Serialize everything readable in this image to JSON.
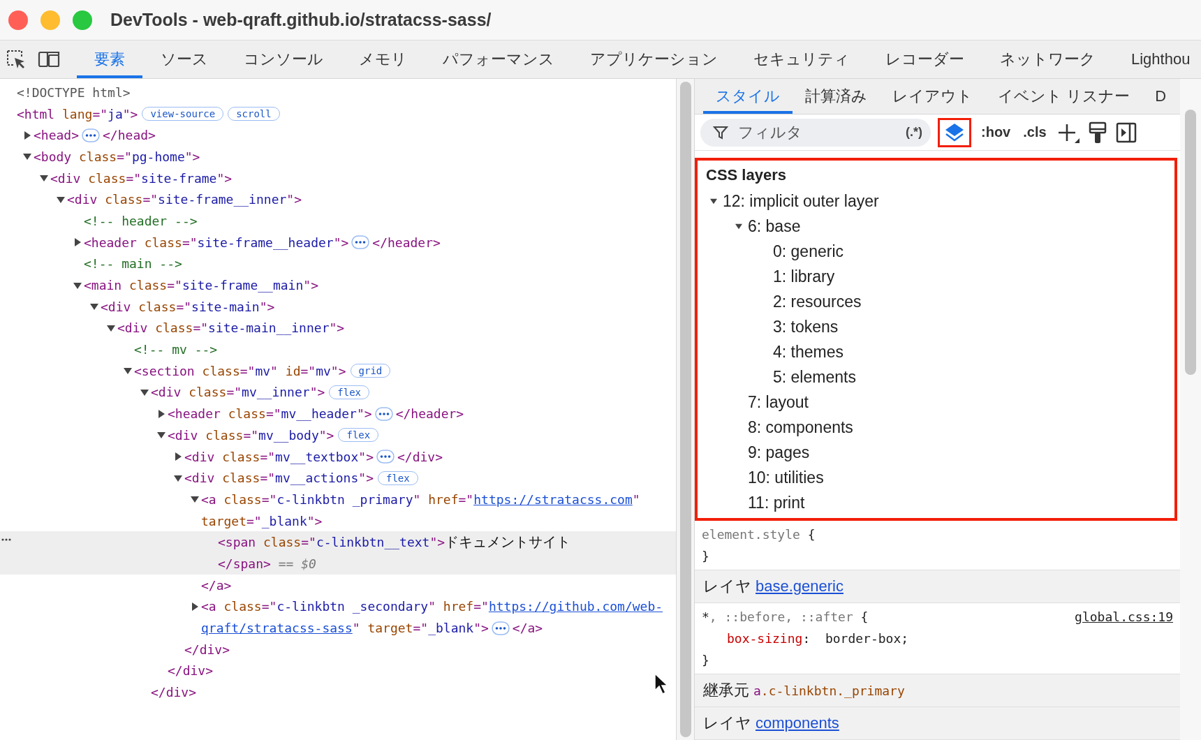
{
  "window": {
    "title": "DevTools - web-qraft.github.io/stratacss-sass/"
  },
  "main_tabs": [
    {
      "label": "要素",
      "selected": true
    },
    {
      "label": "ソース",
      "selected": false
    },
    {
      "label": "コンソール",
      "selected": false
    },
    {
      "label": "メモリ",
      "selected": false
    },
    {
      "label": "パフォーマンス",
      "selected": false
    },
    {
      "label": "アプリケーション",
      "selected": false
    },
    {
      "label": "セキュリティ",
      "selected": false
    },
    {
      "label": "レコーダー",
      "selected": false
    },
    {
      "label": "ネットワーク",
      "selected": false
    },
    {
      "label": "Lighthou",
      "selected": false
    }
  ],
  "dom_tree": {
    "nodes": [
      {
        "selected": false,
        "lines": [
          [
            {
              "kind": "doctype",
              "text": "<!DOCTYPE html>"
            }
          ]
        ]
      },
      {
        "selected": false,
        "lines": [
          [
            {
              "kind": "tag",
              "text": "<html"
            },
            {
              "kind": "attr",
              "text": " lang"
            },
            {
              "kind": "tag",
              "text": "=\""
            },
            {
              "kind": "val",
              "text": "ja"
            },
            {
              "kind": "tag",
              "text": "\">"
            },
            {
              "kind": "badge",
              "text": "view-source"
            },
            {
              "kind": "badge",
              "text": "scroll"
            }
          ]
        ],
        "children": [
          {
            "expanded": false,
            "selected": false,
            "lines": [
              [
                {
                  "kind": "tag",
                  "text": "<head>"
                },
                {
                  "kind": "more"
                },
                {
                  "kind": "tag",
                  "text": "</head>"
                }
              ]
            ]
          },
          {
            "expanded": true,
            "selected": false,
            "lines": [
              [
                {
                  "kind": "tag",
                  "text": "<body"
                },
                {
                  "kind": "attr",
                  "text": " class"
                },
                {
                  "kind": "tag",
                  "text": "=\""
                },
                {
                  "kind": "val",
                  "text": "pg-home"
                },
                {
                  "kind": "tag",
                  "text": "\">"
                }
              ]
            ],
            "children": [
              {
                "expanded": true,
                "selected": false,
                "lines": [
                  [
                    {
                      "kind": "tag",
                      "text": "<div"
                    },
                    {
                      "kind": "attr",
                      "text": " class"
                    },
                    {
                      "kind": "tag",
                      "text": "=\""
                    },
                    {
                      "kind": "val",
                      "text": "site-frame"
                    },
                    {
                      "kind": "tag",
                      "text": "\">"
                    }
                  ]
                ],
                "children": [
                  {
                    "expanded": true,
                    "selected": false,
                    "lines": [
                      [
                        {
                          "kind": "tag",
                          "text": "<div"
                        },
                        {
                          "kind": "attr",
                          "text": " class"
                        },
                        {
                          "kind": "tag",
                          "text": "=\""
                        },
                        {
                          "kind": "val",
                          "text": "site-frame__inner"
                        },
                        {
                          "kind": "tag",
                          "text": "\">"
                        }
                      ]
                    ],
                    "children": [
                      {
                        "selected": false,
                        "lines": [
                          [
                            {
                              "kind": "comment",
                              "text": "<!-- header -->"
                            }
                          ]
                        ]
                      },
                      {
                        "expanded": false,
                        "selected": false,
                        "lines": [
                          [
                            {
                              "kind": "tag",
                              "text": "<header"
                            },
                            {
                              "kind": "attr",
                              "text": " class"
                            },
                            {
                              "kind": "tag",
                              "text": "=\""
                            },
                            {
                              "kind": "val",
                              "text": "site-frame__header"
                            },
                            {
                              "kind": "tag",
                              "text": "\">"
                            },
                            {
                              "kind": "more"
                            },
                            {
                              "kind": "tag",
                              "text": "</header>"
                            }
                          ]
                        ]
                      },
                      {
                        "selected": false,
                        "lines": [
                          [
                            {
                              "kind": "comment",
                              "text": "<!-- main -->"
                            }
                          ]
                        ]
                      },
                      {
                        "expanded": true,
                        "selected": false,
                        "lines": [
                          [
                            {
                              "kind": "tag",
                              "text": "<main"
                            },
                            {
                              "kind": "attr",
                              "text": " class"
                            },
                            {
                              "kind": "tag",
                              "text": "=\""
                            },
                            {
                              "kind": "val",
                              "text": "site-frame__main"
                            },
                            {
                              "kind": "tag",
                              "text": "\">"
                            }
                          ]
                        ],
                        "children": [
                          {
                            "expanded": true,
                            "selected": false,
                            "lines": [
                              [
                                {
                                  "kind": "tag",
                                  "text": "<div"
                                },
                                {
                                  "kind": "attr",
                                  "text": " class"
                                },
                                {
                                  "kind": "tag",
                                  "text": "=\""
                                },
                                {
                                  "kind": "val",
                                  "text": "site-main"
                                },
                                {
                                  "kind": "tag",
                                  "text": "\">"
                                }
                              ]
                            ],
                            "children": [
                              {
                                "expanded": true,
                                "selected": false,
                                "lines": [
                                  [
                                    {
                                      "kind": "tag",
                                      "text": "<div"
                                    },
                                    {
                                      "kind": "attr",
                                      "text": " class"
                                    },
                                    {
                                      "kind": "tag",
                                      "text": "=\""
                                    },
                                    {
                                      "kind": "val",
                                      "text": "site-main__inner"
                                    },
                                    {
                                      "kind": "tag",
                                      "text": "\">"
                                    }
                                  ]
                                ],
                                "children": [
                                  {
                                    "selected": false,
                                    "lines": [
                                      [
                                        {
                                          "kind": "comment",
                                          "text": "<!-- mv -->"
                                        }
                                      ]
                                    ]
                                  },
                                  {
                                    "expanded": true,
                                    "selected": false,
                                    "lines": [
                                      [
                                        {
                                          "kind": "tag",
                                          "text": "<section"
                                        },
                                        {
                                          "kind": "attr",
                                          "text": " class"
                                        },
                                        {
                                          "kind": "tag",
                                          "text": "=\""
                                        },
                                        {
                                          "kind": "val",
                                          "text": "mv"
                                        },
                                        {
                                          "kind": "tag",
                                          "text": "\""
                                        },
                                        {
                                          "kind": "attr",
                                          "text": " id"
                                        },
                                        {
                                          "kind": "tag",
                                          "text": "=\""
                                        },
                                        {
                                          "kind": "val",
                                          "text": "mv"
                                        },
                                        {
                                          "kind": "tag",
                                          "text": "\">"
                                        },
                                        {
                                          "kind": "badge",
                                          "text": "grid"
                                        }
                                      ]
                                    ],
                                    "children": [
                                      {
                                        "expanded": true,
                                        "selected": false,
                                        "lines": [
                                          [
                                            {
                                              "kind": "tag",
                                              "text": "<div"
                                            },
                                            {
                                              "kind": "attr",
                                              "text": " class"
                                            },
                                            {
                                              "kind": "tag",
                                              "text": "=\""
                                            },
                                            {
                                              "kind": "val",
                                              "text": "mv__inner"
                                            },
                                            {
                                              "kind": "tag",
                                              "text": "\">"
                                            },
                                            {
                                              "kind": "badge",
                                              "text": "flex"
                                            }
                                          ]
                                        ],
                                        "children": [
                                          {
                                            "expanded": false,
                                            "selected": false,
                                            "lines": [
                                              [
                                                {
                                                  "kind": "tag",
                                                  "text": "<header"
                                                },
                                                {
                                                  "kind": "attr",
                                                  "text": " class"
                                                },
                                                {
                                                  "kind": "tag",
                                                  "text": "=\""
                                                },
                                                {
                                                  "kind": "val",
                                                  "text": "mv__header"
                                                },
                                                {
                                                  "kind": "tag",
                                                  "text": "\">"
                                                },
                                                {
                                                  "kind": "more"
                                                },
                                                {
                                                  "kind": "tag",
                                                  "text": "</header>"
                                                }
                                              ]
                                            ]
                                          },
                                          {
                                            "expanded": true,
                                            "selected": false,
                                            "lines": [
                                              [
                                                {
                                                  "kind": "tag",
                                                  "text": "<div"
                                                },
                                                {
                                                  "kind": "attr",
                                                  "text": " class"
                                                },
                                                {
                                                  "kind": "tag",
                                                  "text": "=\""
                                                },
                                                {
                                                  "kind": "val",
                                                  "text": "mv__body"
                                                },
                                                {
                                                  "kind": "tag",
                                                  "text": "\">"
                                                },
                                                {
                                                  "kind": "badge",
                                                  "text": "flex"
                                                }
                                              ]
                                            ],
                                            "children": [
                                              {
                                                "expanded": false,
                                                "selected": false,
                                                "lines": [
                                                  [
                                                    {
                                                      "kind": "tag",
                                                      "text": "<div"
                                                    },
                                                    {
                                                      "kind": "attr",
                                                      "text": " class"
                                                    },
                                                    {
                                                      "kind": "tag",
                                                      "text": "=\""
                                                    },
                                                    {
                                                      "kind": "val",
                                                      "text": "mv__textbox"
                                                    },
                                                    {
                                                      "kind": "tag",
                                                      "text": "\">"
                                                    },
                                                    {
                                                      "kind": "more"
                                                    },
                                                    {
                                                      "kind": "tag",
                                                      "text": "</div>"
                                                    }
                                                  ]
                                                ]
                                              },
                                              {
                                                "expanded": true,
                                                "selected": false,
                                                "lines": [
                                                  [
                                                    {
                                                      "kind": "tag",
                                                      "text": "<div"
                                                    },
                                                    {
                                                      "kind": "attr",
                                                      "text": " class"
                                                    },
                                                    {
                                                      "kind": "tag",
                                                      "text": "=\""
                                                    },
                                                    {
                                                      "kind": "val",
                                                      "text": "mv__actions"
                                                    },
                                                    {
                                                      "kind": "tag",
                                                      "text": "\">"
                                                    },
                                                    {
                                                      "kind": "badge",
                                                      "text": "flex"
                                                    }
                                                  ]
                                                ],
                                                "children": [
                                                  {
                                                    "expanded": true,
                                                    "selected": false,
                                                    "lines": [
                                                      [
                                                        {
                                                          "kind": "tag",
                                                          "text": "<a"
                                                        },
                                                        {
                                                          "kind": "attr",
                                                          "text": " class"
                                                        },
                                                        {
                                                          "kind": "tag",
                                                          "text": "=\""
                                                        },
                                                        {
                                                          "kind": "val",
                                                          "text": "c-linkbtn _primary"
                                                        },
                                                        {
                                                          "kind": "tag",
                                                          "text": "\""
                                                        },
                                                        {
                                                          "kind": "attr",
                                                          "text": " href"
                                                        },
                                                        {
                                                          "kind": "tag",
                                                          "text": "=\""
                                                        },
                                                        {
                                                          "kind": "link",
                                                          "text": "https://stratacss.com"
                                                        },
                                                        {
                                                          "kind": "tag",
                                                          "text": "\""
                                                        }
                                                      ],
                                                      [
                                                        {
                                                          "kind": "attr",
                                                          "text": "target"
                                                        },
                                                        {
                                                          "kind": "tag",
                                                          "text": "=\""
                                                        },
                                                        {
                                                          "kind": "val",
                                                          "text": "_blank"
                                                        },
                                                        {
                                                          "kind": "tag",
                                                          "text": "\">"
                                                        }
                                                      ]
                                                    ],
                                                    "children": [
                                                      {
                                                        "selected": true,
                                                        "lines": [
                                                          [
                                                            {
                                                              "kind": "tag",
                                                              "text": "<span"
                                                            },
                                                            {
                                                              "kind": "attr",
                                                              "text": " class"
                                                            },
                                                            {
                                                              "kind": "tag",
                                                              "text": "=\""
                                                            },
                                                            {
                                                              "kind": "val",
                                                              "text": "c-linkbtn__text"
                                                            },
                                                            {
                                                              "kind": "tag",
                                                              "text": "\">"
                                                            },
                                                            {
                                                              "kind": "text",
                                                              "text": "ドキュメントサイト"
                                                            }
                                                          ],
                                                          [
                                                            {
                                                              "kind": "tag",
                                                              "text": "</span>"
                                                            },
                                                            {
                                                              "kind": "dim",
                                                              "text": " == $0"
                                                            }
                                                          ]
                                                        ]
                                                      }
                                                    ],
                                                    "closing": [
                                                      [
                                                        {
                                                          "kind": "tag",
                                                          "text": "</a>"
                                                        }
                                                      ]
                                                    ]
                                                  },
                                                  {
                                                    "expanded": false,
                                                    "selected": false,
                                                    "lines": [
                                                      [
                                                        {
                                                          "kind": "tag",
                                                          "text": "<a"
                                                        },
                                                        {
                                                          "kind": "attr",
                                                          "text": " class"
                                                        },
                                                        {
                                                          "kind": "tag",
                                                          "text": "=\""
                                                        },
                                                        {
                                                          "kind": "val",
                                                          "text": "c-linkbtn _secondary"
                                                        },
                                                        {
                                                          "kind": "tag",
                                                          "text": "\""
                                                        },
                                                        {
                                                          "kind": "attr",
                                                          "text": " href"
                                                        },
                                                        {
                                                          "kind": "tag",
                                                          "text": "=\""
                                                        },
                                                        {
                                                          "kind": "link",
                                                          "text": "https://github.com/web-"
                                                        }
                                                      ],
                                                      [
                                                        {
                                                          "kind": "link",
                                                          "text": "qraft/stratacss-sass"
                                                        },
                                                        {
                                                          "kind": "tag",
                                                          "text": "\""
                                                        },
                                                        {
                                                          "kind": "attr",
                                                          "text": " target"
                                                        },
                                                        {
                                                          "kind": "tag",
                                                          "text": "=\""
                                                        },
                                                        {
                                                          "kind": "val",
                                                          "text": "_blank"
                                                        },
                                                        {
                                                          "kind": "tag",
                                                          "text": "\">"
                                                        },
                                                        {
                                                          "kind": "more"
                                                        },
                                                        {
                                                          "kind": "tag",
                                                          "text": "</a>"
                                                        }
                                                      ]
                                                    ]
                                                  }
                                                ],
                                                "closing": [
                                                  [
                                                    {
                                                      "kind": "tag",
                                                      "text": "</div>"
                                                    }
                                                  ]
                                                ]
                                              }
                                            ],
                                            "closing": [
                                              [
                                                {
                                                  "kind": "tag",
                                                  "text": "</div>"
                                                }
                                              ]
                                            ]
                                          }
                                        ],
                                        "closing": [
                                          [
                                            {
                                              "kind": "tag",
                                              "text": "</div>"
                                            }
                                          ]
                                        ]
                                      }
                                    ]
                                  }
                                ]
                              }
                            ]
                          }
                        ]
                      }
                    ]
                  }
                ]
              }
            ]
          }
        ]
      }
    ]
  },
  "styles_pane": {
    "tabs": [
      {
        "label": "スタイル",
        "selected": true
      },
      {
        "label": "計算済み",
        "selected": false
      },
      {
        "label": "レイアウト",
        "selected": false
      },
      {
        "label": "イベント リスナー",
        "selected": false
      },
      {
        "label": "D",
        "selected": false
      }
    ],
    "filter": {
      "placeholder": "フィルタ",
      "regex_label": "(.*)"
    },
    "layers_toggle": {
      "on": true
    },
    "toolbar_buttons": [
      ":hov",
      ".cls"
    ],
    "css_layers": {
      "title": "CSS layers",
      "tree": [
        {
          "label": "12: implicit outer layer",
          "expanded": true,
          "children": [
            {
              "label": "6: base",
              "expanded": true,
              "children": [
                {
                  "label": "0: generic"
                },
                {
                  "label": "1: library"
                },
                {
                  "label": "2: resources"
                },
                {
                  "label": "3: tokens"
                },
                {
                  "label": "4: themes"
                },
                {
                  "label": "5: elements"
                }
              ]
            },
            {
              "label": "7: layout"
            },
            {
              "label": "8: components"
            },
            {
              "label": "9: pages"
            },
            {
              "label": "10: utilities"
            },
            {
              "label": "11: print"
            }
          ]
        }
      ]
    },
    "sections": [
      {
        "kind": "rule",
        "selector_parts": [
          {
            "text": "element.style",
            "matched": false
          }
        ],
        "open": "{",
        "close": "}"
      },
      {
        "kind": "layer",
        "prefix": "レイヤ",
        "link": "base.generic"
      },
      {
        "kind": "rule",
        "selector_parts": [
          {
            "text": "*",
            "matched": true
          },
          {
            "text": ", ::before, ::after",
            "matched": false
          }
        ],
        "open": "{",
        "source": "global.css:19",
        "declarations": [
          {
            "property": "box-sizing",
            "separator": ":",
            "value": "border-box;"
          }
        ],
        "close": "}"
      },
      {
        "kind": "inherited",
        "prefix": "継承元",
        "selector": [
          {
            "kind": "tag",
            "text": "a"
          },
          {
            "kind": "attr",
            "text": ".c-linkbtn._primary"
          }
        ]
      },
      {
        "kind": "layer",
        "prefix": "レイヤ",
        "link": "components"
      }
    ]
  }
}
